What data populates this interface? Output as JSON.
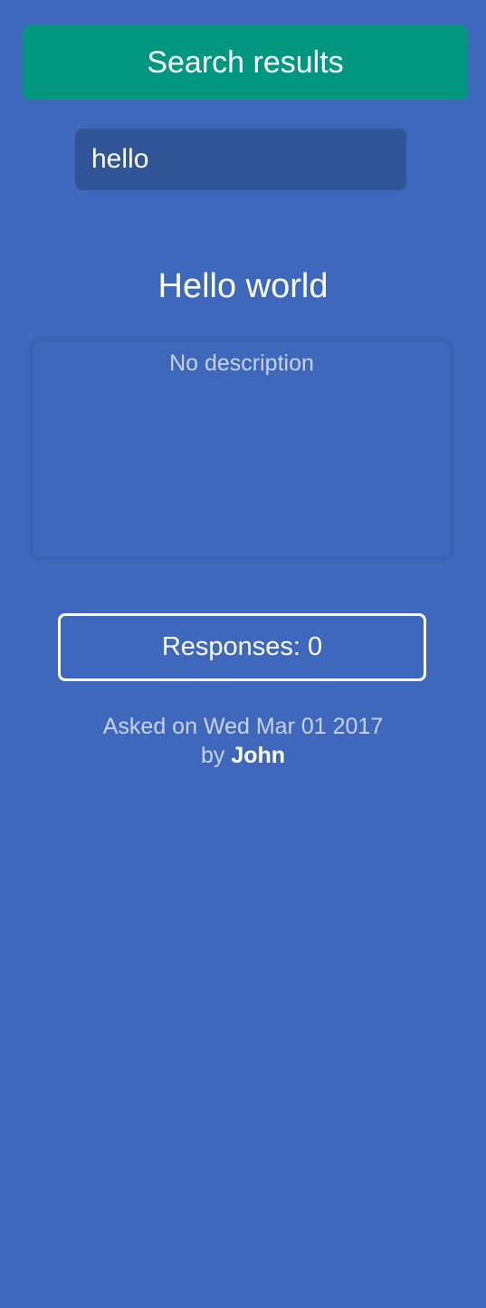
{
  "header": {
    "title": "Search results"
  },
  "search": {
    "value": "hello"
  },
  "result": {
    "title": "Hello world",
    "description": "No description",
    "responses_label": "Responses: 0",
    "asked_prefix": "Asked on",
    "asked_date": "Wed Mar 01 2017",
    "by_prefix": "by",
    "author": "John"
  },
  "colors": {
    "background": "#3d68bb",
    "header": "#009781",
    "input": "#2f5596"
  }
}
